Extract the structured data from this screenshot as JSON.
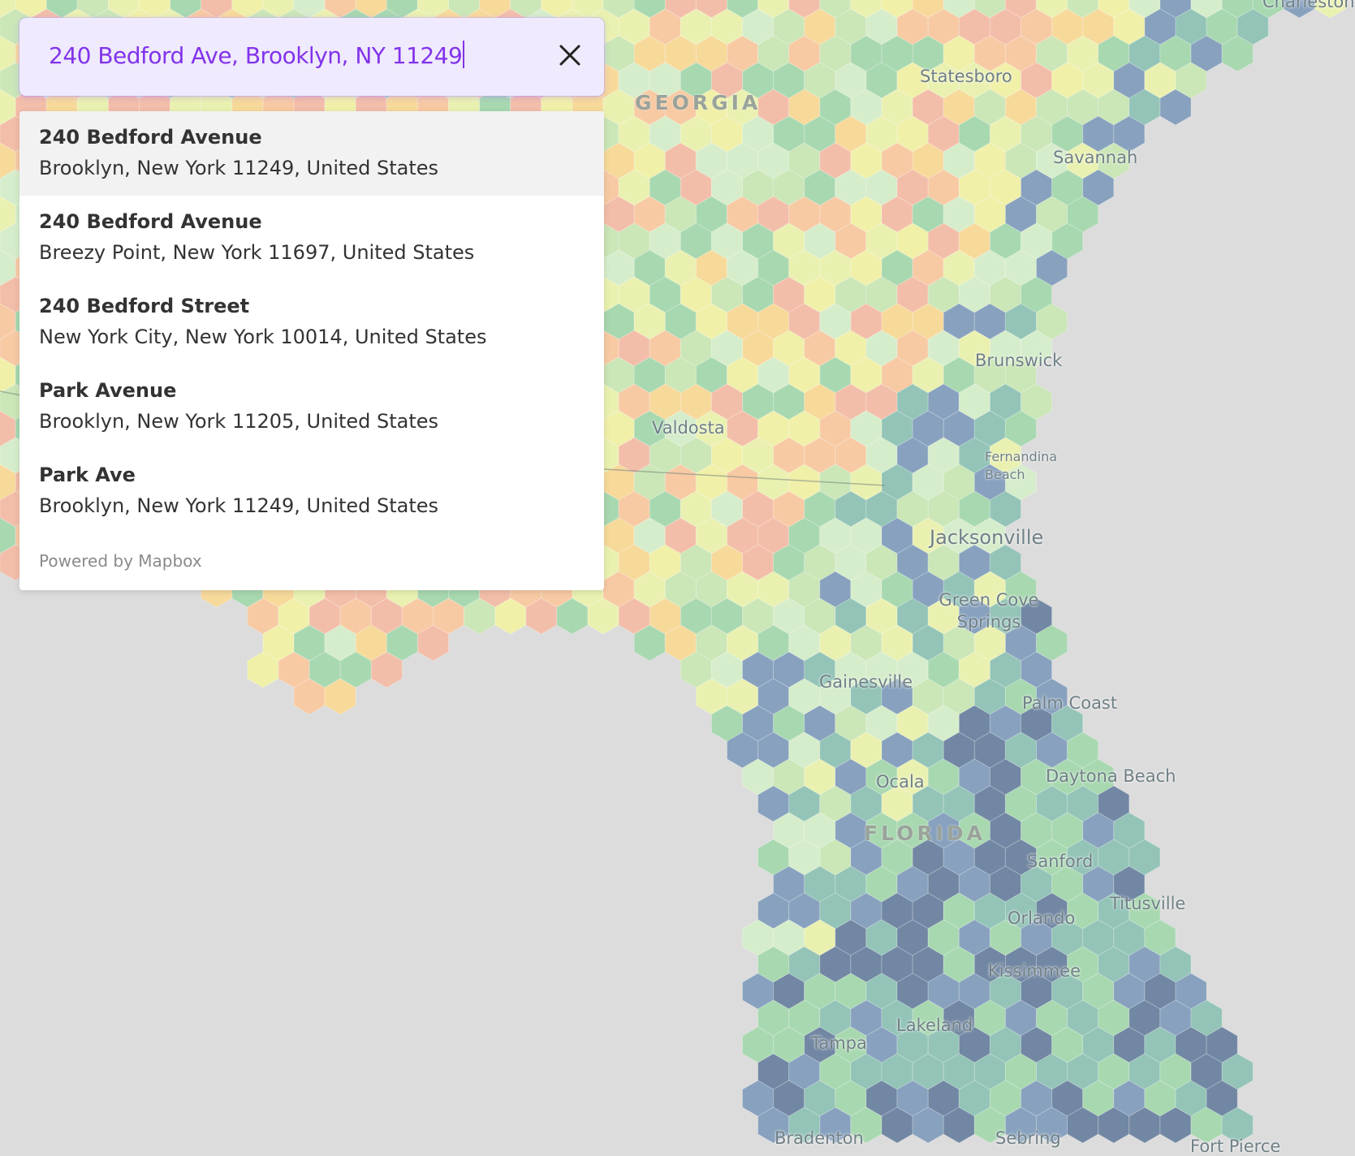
{
  "search": {
    "value": "240 Bedford Ave, Brooklyn, NY 11249",
    "clear_icon": "close-icon"
  },
  "suggestions": [
    {
      "title": "240 Bedford Avenue",
      "subtitle": "Brooklyn, New York 11249, United States"
    },
    {
      "title": "240 Bedford Avenue",
      "subtitle": "Breezy Point, New York 11697, United States"
    },
    {
      "title": "240 Bedford Street",
      "subtitle": "New York City, New York 10014, United States"
    },
    {
      "title": "Park Avenue",
      "subtitle": "Brooklyn, New York 11205, United States"
    },
    {
      "title": "Park Ave",
      "subtitle": "Brooklyn, New York 11249, United States"
    }
  ],
  "attribution": "Powered by Mapbox",
  "map": {
    "states": [
      "GEORGIA",
      "FLORIDA"
    ],
    "cities": [
      "Charleston",
      "Statesboro",
      "Savannah",
      "Brunswick",
      "Valdosta",
      "Fernandina Beach",
      "Jacksonville",
      "Green Cove Springs",
      "Gainesville",
      "Palm Coast",
      "Daytona Beach",
      "Ocala",
      "Sanford",
      "Titusville",
      "Orlando",
      "Kissimmee",
      "Lakeland",
      "Tampa",
      "Bradenton",
      "Sebring",
      "Fort Pierce"
    ],
    "palette": [
      "#5e7899",
      "#7897b8",
      "#86bfb0",
      "#9fd7a8",
      "#c8e8b0",
      "#d5f0c8",
      "#ecf4a8",
      "#f3f3a0",
      "#fbd88e",
      "#fbc79a",
      "#f7b8a0"
    ]
  }
}
